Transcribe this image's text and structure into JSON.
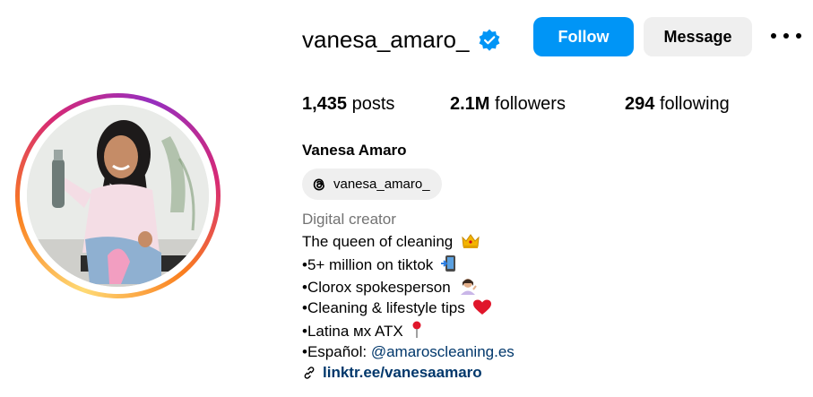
{
  "profile": {
    "username": "vanesa_amaro_",
    "full_name": "Vanesa Amaro",
    "verified": true,
    "threads_handle": "vanesa_amaro_"
  },
  "actions": {
    "follow_label": "Follow",
    "message_label": "Message"
  },
  "stats": {
    "posts_count": "1,435",
    "posts_label": "posts",
    "followers_count": "2.1M",
    "followers_label": "followers",
    "following_count": "294",
    "following_label": "following"
  },
  "bio": {
    "category": "Digital creator",
    "lines": [
      "The queen of cleaning",
      "•5+ million on tiktok",
      "•Clorox spokesperson",
      "•Cleaning & lifestyle tips",
      "•Latina ᴍx ATX",
      "•Español: "
    ],
    "mention": "@amaroscleaning.es",
    "link_text": "linktr.ee/vanesaamaro"
  },
  "icons": {
    "verified": "verified-badge-icon",
    "more": "more-options-icon",
    "threads": "threads-icon",
    "link": "link-icon"
  },
  "colors": {
    "primary_button": "#0095f6",
    "secondary_button": "#efefef",
    "link": "#00376b",
    "category": "#737373"
  }
}
